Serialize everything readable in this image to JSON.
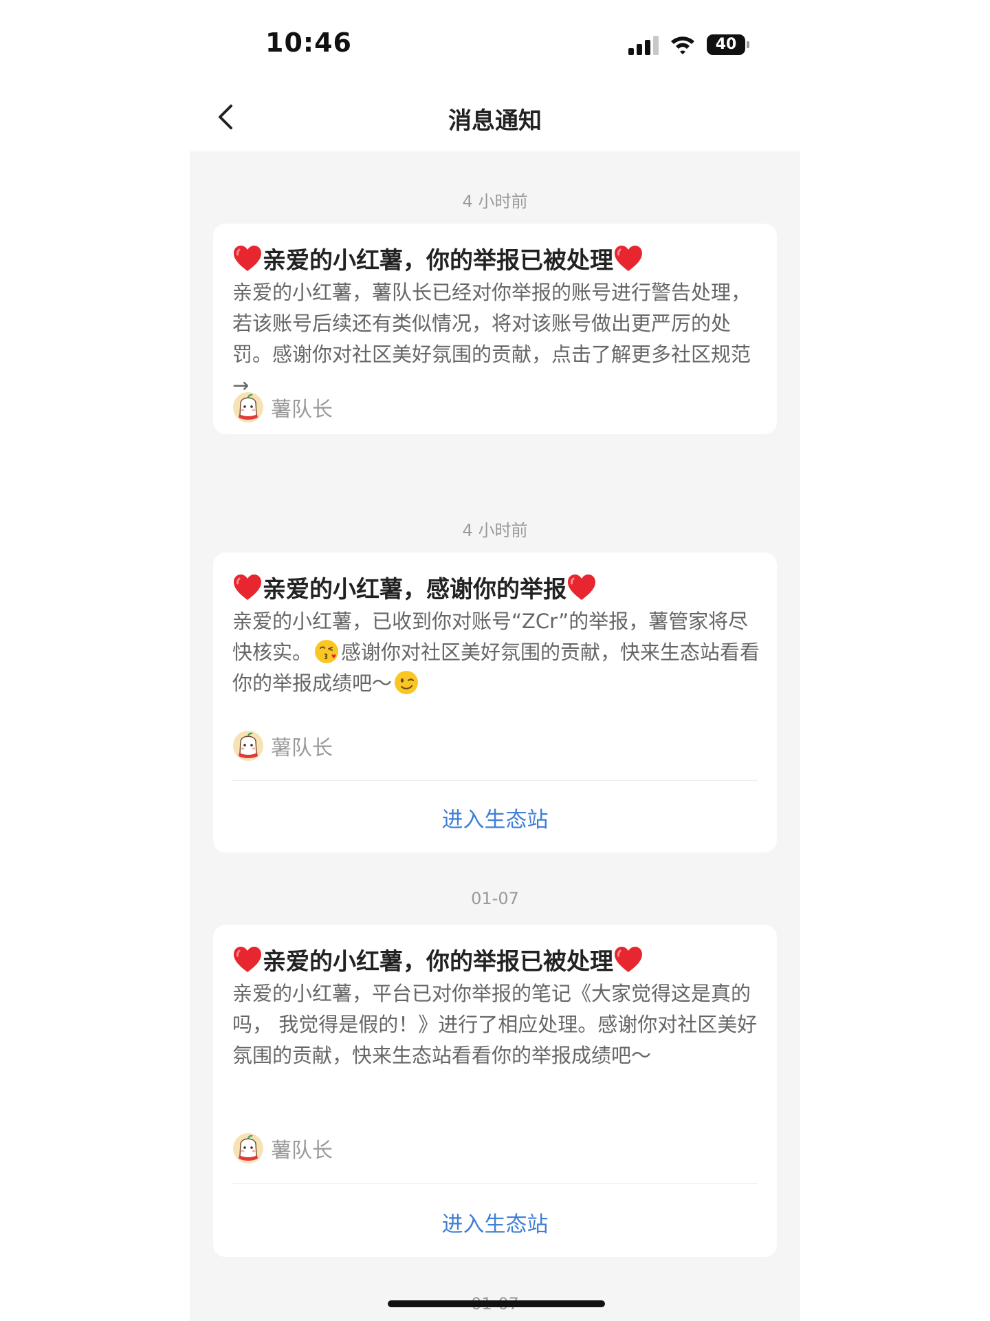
{
  "status": {
    "time": "10:46",
    "battery": "40"
  },
  "nav": {
    "title": "消息通知"
  },
  "messages": [
    {
      "time": "4 小时前",
      "title": "亲爱的小红薯，你的举报已被处理",
      "body": "亲爱的小红薯，薯队长已经对你举报的账号进行警告处理，若该账号后续还有类似情况，将对该账号做出更严厉的处罚。感谢你对社区美好氛围的贡献，点击了解更多社区规范 →",
      "sender": "薯队长"
    },
    {
      "time": "4 小时前",
      "title": "亲爱的小红薯，感谢你的举报",
      "body_part1": "亲爱的小红薯，已收到你对账号“ZCr”的举报，薯管家将尽快核实。",
      "body_part2": "感谢你对社区美好氛围的贡献，快来生态站看看你的举报成绩吧～",
      "sender": "薯队长",
      "action": "进入生态站"
    },
    {
      "time": "01-07",
      "title": "亲爱的小红薯，你的举报已被处理",
      "body": "亲爱的小红薯，平台已对你举报的笔记《大家觉得这是真的吗， 我觉得是假的！》进行了相应处理。感谢你对社区美好氛围的贡献，快来生态站看看你的举报成绩吧～",
      "sender": "薯队长",
      "action": "进入生态站"
    },
    {
      "time": "01-07"
    }
  ],
  "colors": {
    "accent": "#3f7fd6",
    "heart": "#e8262f",
    "background": "#f5f5f5"
  }
}
